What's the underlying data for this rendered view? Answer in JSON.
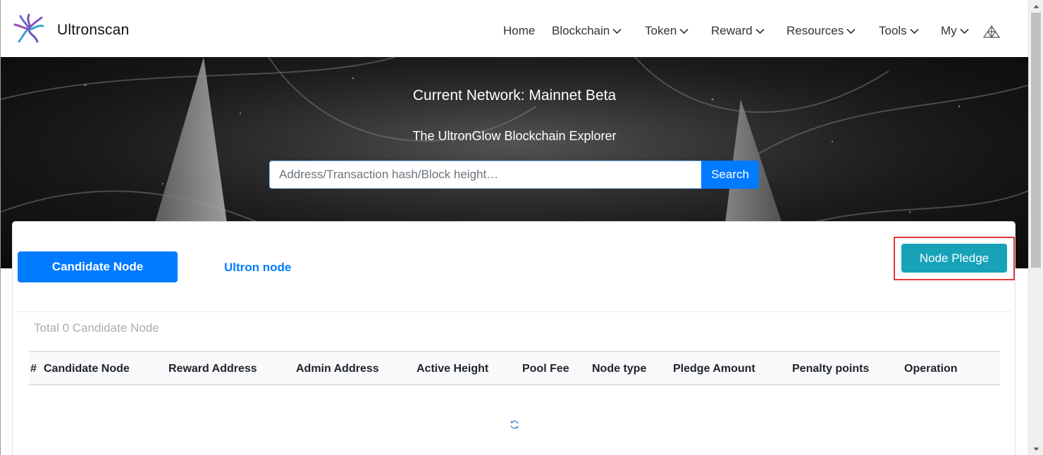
{
  "brand": {
    "name": "Ultronscan"
  },
  "nav": {
    "items": [
      {
        "label": "Home",
        "dropdown": false
      },
      {
        "label": "Blockchain",
        "dropdown": true
      },
      {
        "label": "Token",
        "dropdown": true
      },
      {
        "label": "Reward",
        "dropdown": true
      },
      {
        "label": "Resources",
        "dropdown": true
      },
      {
        "label": "Tools",
        "dropdown": true
      },
      {
        "label": "My",
        "dropdown": true
      }
    ],
    "extra_icon": "triangle-network-icon"
  },
  "hero": {
    "title": "Current Network: Mainnet Beta",
    "subtitle": "The UltronGlow Blockchain Explorer",
    "search": {
      "placeholder": "Address/Transaction hash/Block height…",
      "button_label": "Search"
    }
  },
  "tabs": {
    "active_label": "Candidate Node",
    "other_label": "Ultron node"
  },
  "actions": {
    "node_pledge_label": "Node Pledge"
  },
  "summary": {
    "total_text": "Total 0 Candidate Node"
  },
  "table": {
    "columns": [
      "#",
      "Candidate Node",
      "Reward Address",
      "Admin Address",
      "Active Height",
      "Pool Fee",
      "Node type",
      "Pledge Amount",
      "Penalty points",
      "Operation"
    ],
    "rows": []
  },
  "colors": {
    "primary": "#007bff",
    "info": "#17a2b8",
    "highlight_outline": "#e03b3b",
    "muted_text": "#a9aeb3"
  }
}
